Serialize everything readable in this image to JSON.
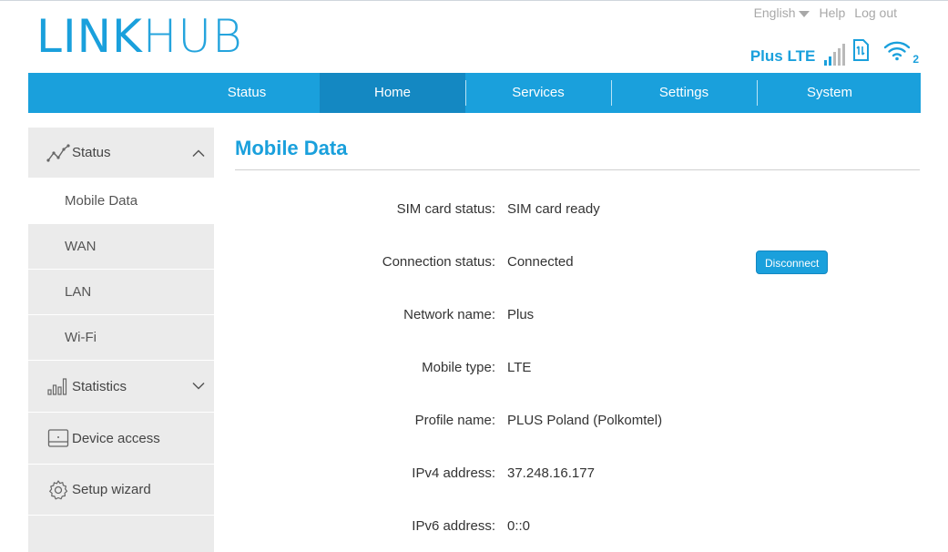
{
  "logo": {
    "bold": "LINK",
    "light": "HUB"
  },
  "top_links": {
    "language": "English",
    "help": "Help",
    "logout": "Log out"
  },
  "status_bar": {
    "network": "Plus LTE",
    "wifi_clients": "2",
    "signal_bars": 2,
    "signal_max": 5
  },
  "nav": [
    {
      "label": "Status",
      "active": false
    },
    {
      "label": "Home",
      "active": true
    },
    {
      "label": "Services",
      "active": false
    },
    {
      "label": "Settings",
      "active": false
    },
    {
      "label": "System",
      "active": false
    }
  ],
  "sidebar": {
    "status": "Status",
    "status_items": [
      "Mobile Data",
      "WAN",
      "LAN",
      "Wi-Fi"
    ],
    "statistics": "Statistics",
    "device_access": "Device access",
    "setup_wizard": "Setup wizard"
  },
  "main": {
    "title": "Mobile Data",
    "rows": [
      {
        "label": "SIM card status:",
        "value": "SIM card ready"
      },
      {
        "label": "Connection status:",
        "value": "Connected"
      },
      {
        "label": "Network name:",
        "value": "Plus"
      },
      {
        "label": "Mobile type:",
        "value": "LTE"
      },
      {
        "label": "Profile name:",
        "value": "PLUS Poland (Polkomtel)"
      },
      {
        "label": "IPv4 address:",
        "value": "37.248.16.177"
      },
      {
        "label": "IPv6 address:",
        "value": "0::0"
      }
    ],
    "disconnect_label": "Disconnect"
  },
  "colors": {
    "accent": "#1aa0dc",
    "accent_dark": "#1488c2",
    "sidebar_bg": "#ebebeb",
    "muted": "#a8a8a8"
  }
}
